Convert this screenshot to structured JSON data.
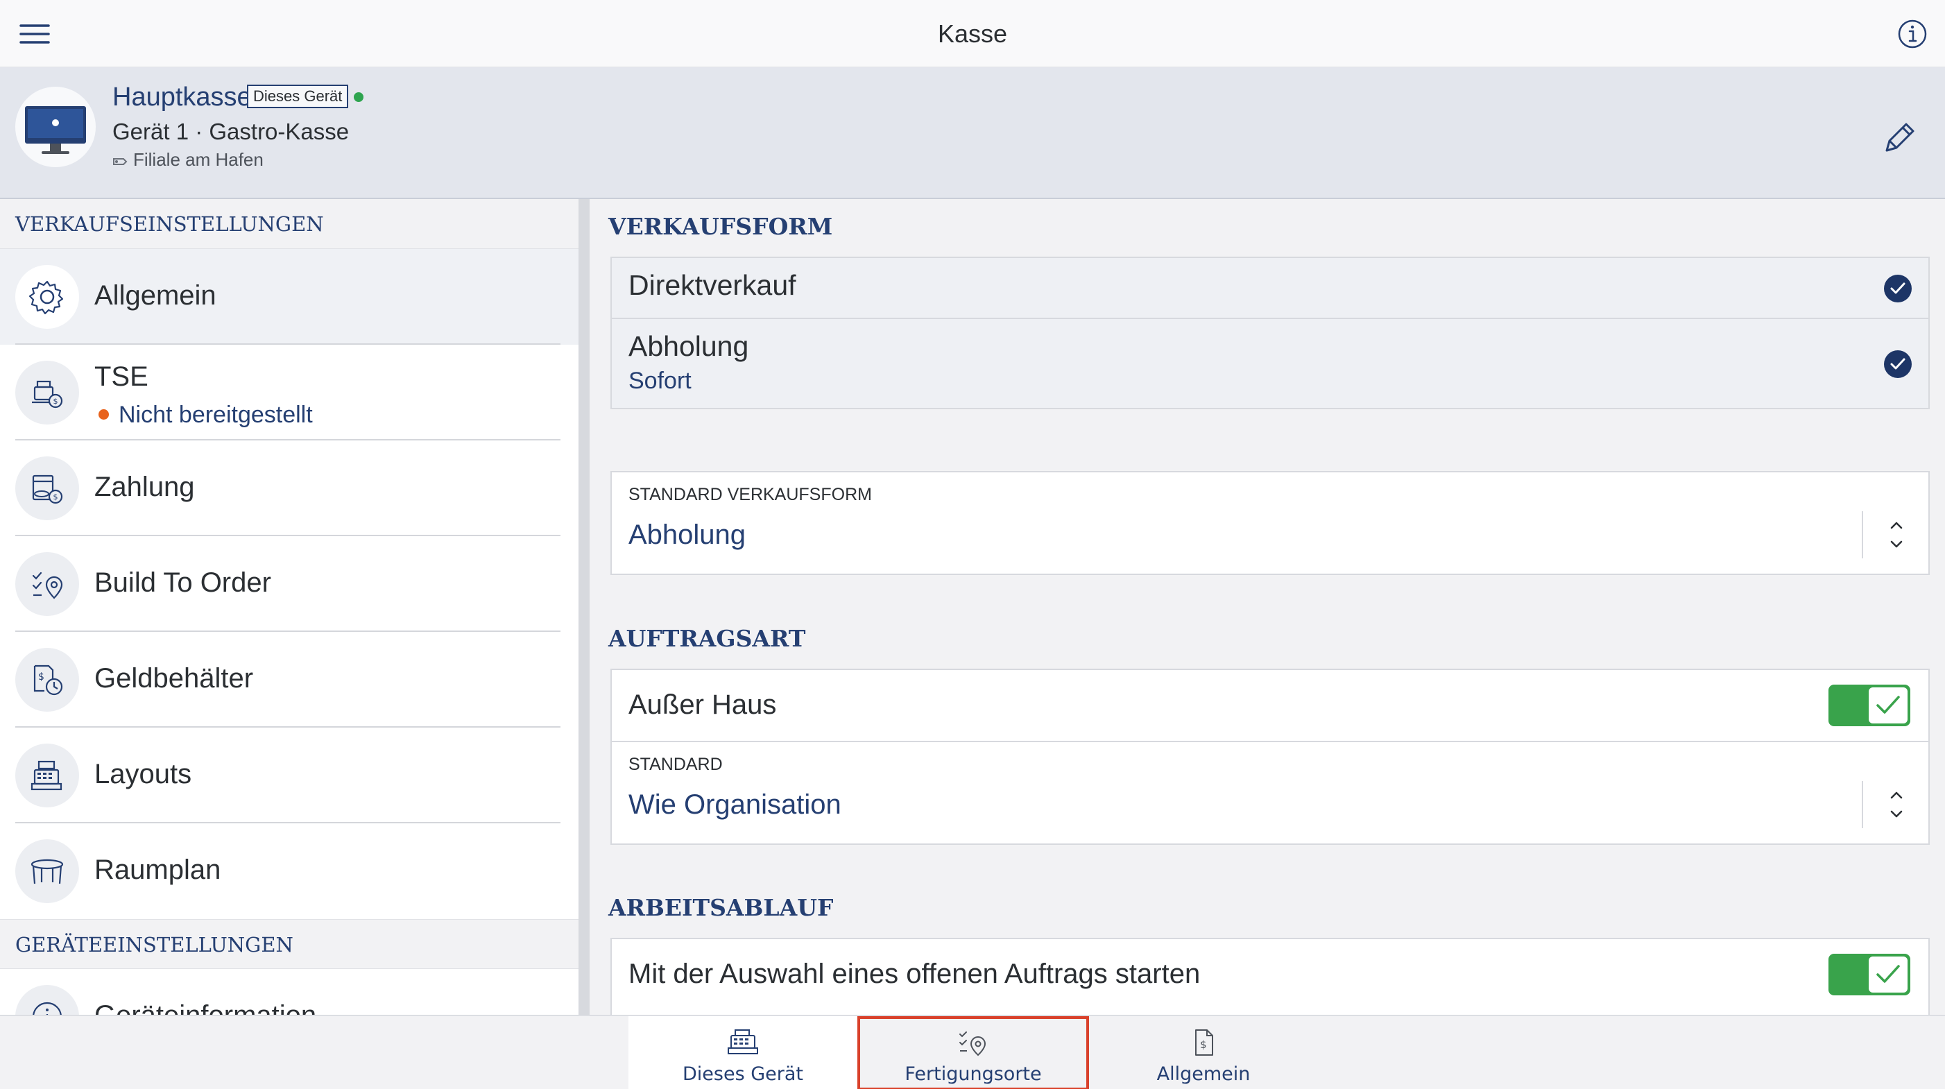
{
  "navbar": {
    "title": "Kasse",
    "menu_icon": "hamburger-menu-icon",
    "info_icon": "info-icon"
  },
  "device": {
    "name": "Hauptkasse",
    "badge": "Dieses Gerät",
    "status_color": "#2ea44f",
    "subtitle": "Gerät 1 · Gastro-Kasse",
    "branch": "Filiale am Hafen",
    "edit_icon": "pencil-icon"
  },
  "sidebar": {
    "section_sales": "VERKAUFSEINSTELLUNGEN",
    "items": [
      {
        "label": "Allgemein",
        "icon": "gear-icon"
      },
      {
        "label": "TSE",
        "status": "Nicht bereitgestellt",
        "icon": "tse-register-icon"
      },
      {
        "label": "Zahlung",
        "icon": "payment-icon"
      },
      {
        "label": "Build To Order",
        "icon": "build-to-order-icon"
      },
      {
        "label": "Geldbehälter",
        "icon": "cash-drawer-icon"
      },
      {
        "label": "Layouts",
        "icon": "layouts-icon"
      },
      {
        "label": "Raumplan",
        "icon": "table-icon"
      }
    ],
    "section_device": "GERÄTEEINSTELLUNGEN",
    "device_item": {
      "label": "Geräteinformation",
      "icon": "info-icon"
    }
  },
  "content": {
    "verkaufsform": {
      "header": "VERKAUFSFORM",
      "options": [
        {
          "title": "Direktverkauf",
          "checked": true
        },
        {
          "title": "Abholung",
          "subtitle": "Sofort",
          "checked": true
        }
      ]
    },
    "standard_verkaufsform": {
      "label": "STANDARD VERKAUFSFORM",
      "value": "Abholung"
    },
    "auftragsart": {
      "header": "AUFTRAGSART",
      "row": {
        "label": "Außer Haus",
        "enabled": true
      },
      "standard": {
        "label": "STANDARD",
        "value": "Wie Organisation"
      }
    },
    "arbeitsablauf": {
      "header": "ARBEITSABLAUF",
      "row": {
        "label": "Mit der Auswahl eines offenen Auftrags starten",
        "enabled": true
      }
    }
  },
  "tabs": [
    {
      "label": "Dieses Gerät",
      "icon": "cash-register-icon",
      "active": true
    },
    {
      "label": "Fertigungsorte",
      "icon": "production-location-icon",
      "highlighted": true
    },
    {
      "label": "Allgemein",
      "icon": "document-dollar-icon"
    }
  ],
  "colors": {
    "accent": "#253f72",
    "toggle_on": "#39a34b",
    "highlight": "#d9412b",
    "warning": "#e8621c"
  }
}
